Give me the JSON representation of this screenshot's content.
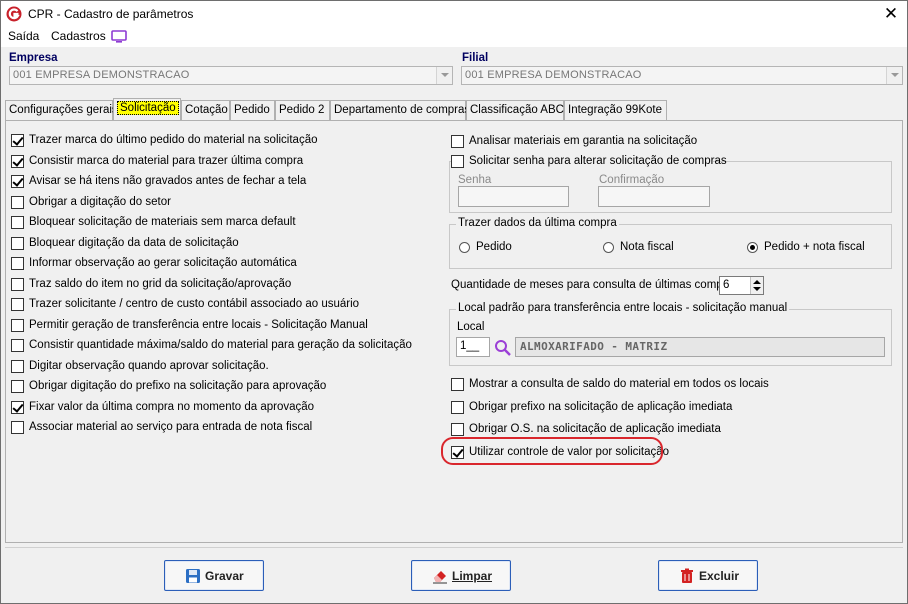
{
  "window": {
    "title": "CPR - Cadastro de parâmetros"
  },
  "menu": {
    "items": [
      "Saída",
      "Cadastros"
    ]
  },
  "empresa": {
    "label": "Empresa",
    "value": "001 EMPRESA DEMONSTRACAO"
  },
  "filial": {
    "label": "Filial",
    "value": "001 EMPRESA DEMONSTRACAO"
  },
  "tabs": [
    "Configurações gerais",
    "Solicitação",
    "Cotação",
    "Pedido",
    "Pedido 2",
    "Departamento de compras",
    "Classificação ABC",
    "Integração 99Kote"
  ],
  "active_tab": "Solicitação",
  "left_options": [
    {
      "label": "Trazer marca do último pedido do material na solicitação",
      "checked": true
    },
    {
      "label": "Consistir marca do material para trazer última compra",
      "checked": true
    },
    {
      "label": "Avisar se há itens não gravados antes de fechar a tela",
      "checked": true
    },
    {
      "label": "Obrigar a digitação do setor",
      "checked": false
    },
    {
      "label": "Bloquear solicitação de materiais sem marca default",
      "checked": false
    },
    {
      "label": "Bloquear digitação da data de solicitação",
      "checked": false
    },
    {
      "label": "Informar observação ao gerar solicitação automática",
      "checked": false
    },
    {
      "label": "Traz saldo do item no grid da solicitação/aprovação",
      "checked": false
    },
    {
      "label": "Trazer solicitante / centro de custo contábil associado ao usuário",
      "checked": false
    },
    {
      "label": "Permitir geração de transferência entre locais - Solicitação Manual",
      "checked": false
    },
    {
      "label": "Consistir quantidade máxima/saldo do material para geração da solicitação",
      "checked": false
    },
    {
      "label": "Digitar observação quando aprovar solicitação.",
      "checked": false
    },
    {
      "label": "Obrigar digitação do prefixo na solicitação para aprovação",
      "checked": false
    },
    {
      "label": "Fixar valor da última compra no momento da aprovação",
      "checked": true
    },
    {
      "label": "Associar material ao serviço para entrada de nota fiscal",
      "checked": false
    }
  ],
  "right": {
    "garantia": {
      "label": "Analisar materiais em garantia na solicitação",
      "checked": false
    },
    "senha_group": {
      "label": "Solicitar senha para alterar solicitação de compras",
      "checked": false,
      "senha_label": "Senha",
      "confirmacao_label": "Confirmação"
    },
    "ultima_compra": {
      "title": "Trazer dados da última compra",
      "options": [
        "Pedido",
        "Nota fiscal",
        "Pedido + nota fiscal"
      ],
      "selected": "Pedido + nota fiscal"
    },
    "meses": {
      "label": "Quantidade de meses para consulta de últimas compras",
      "value": "6"
    },
    "local": {
      "title": "Local padrão para transferência entre locais - solicitação manual",
      "field_label": "Local",
      "code": "1__",
      "description": "ALMOXARIFADO - MATRIZ"
    },
    "bottom_options": [
      {
        "label": "Mostrar a consulta de saldo do material em todos os locais",
        "checked": false
      },
      {
        "label": "Obrigar prefixo na solicitação de aplicação imediata",
        "checked": false
      },
      {
        "label": "Obrigar O.S. na solicitação de aplicação imediata",
        "checked": false
      },
      {
        "label": "Utilizar controle de valor por solicitação",
        "checked": true
      }
    ]
  },
  "buttons": {
    "gravar": "Gravar",
    "limpar": "Limpar",
    "excluir": "Excluir"
  },
  "colors": {
    "highlight": "#d9262c",
    "button_border": "#2b5eb8",
    "label_blue": "#000060"
  }
}
